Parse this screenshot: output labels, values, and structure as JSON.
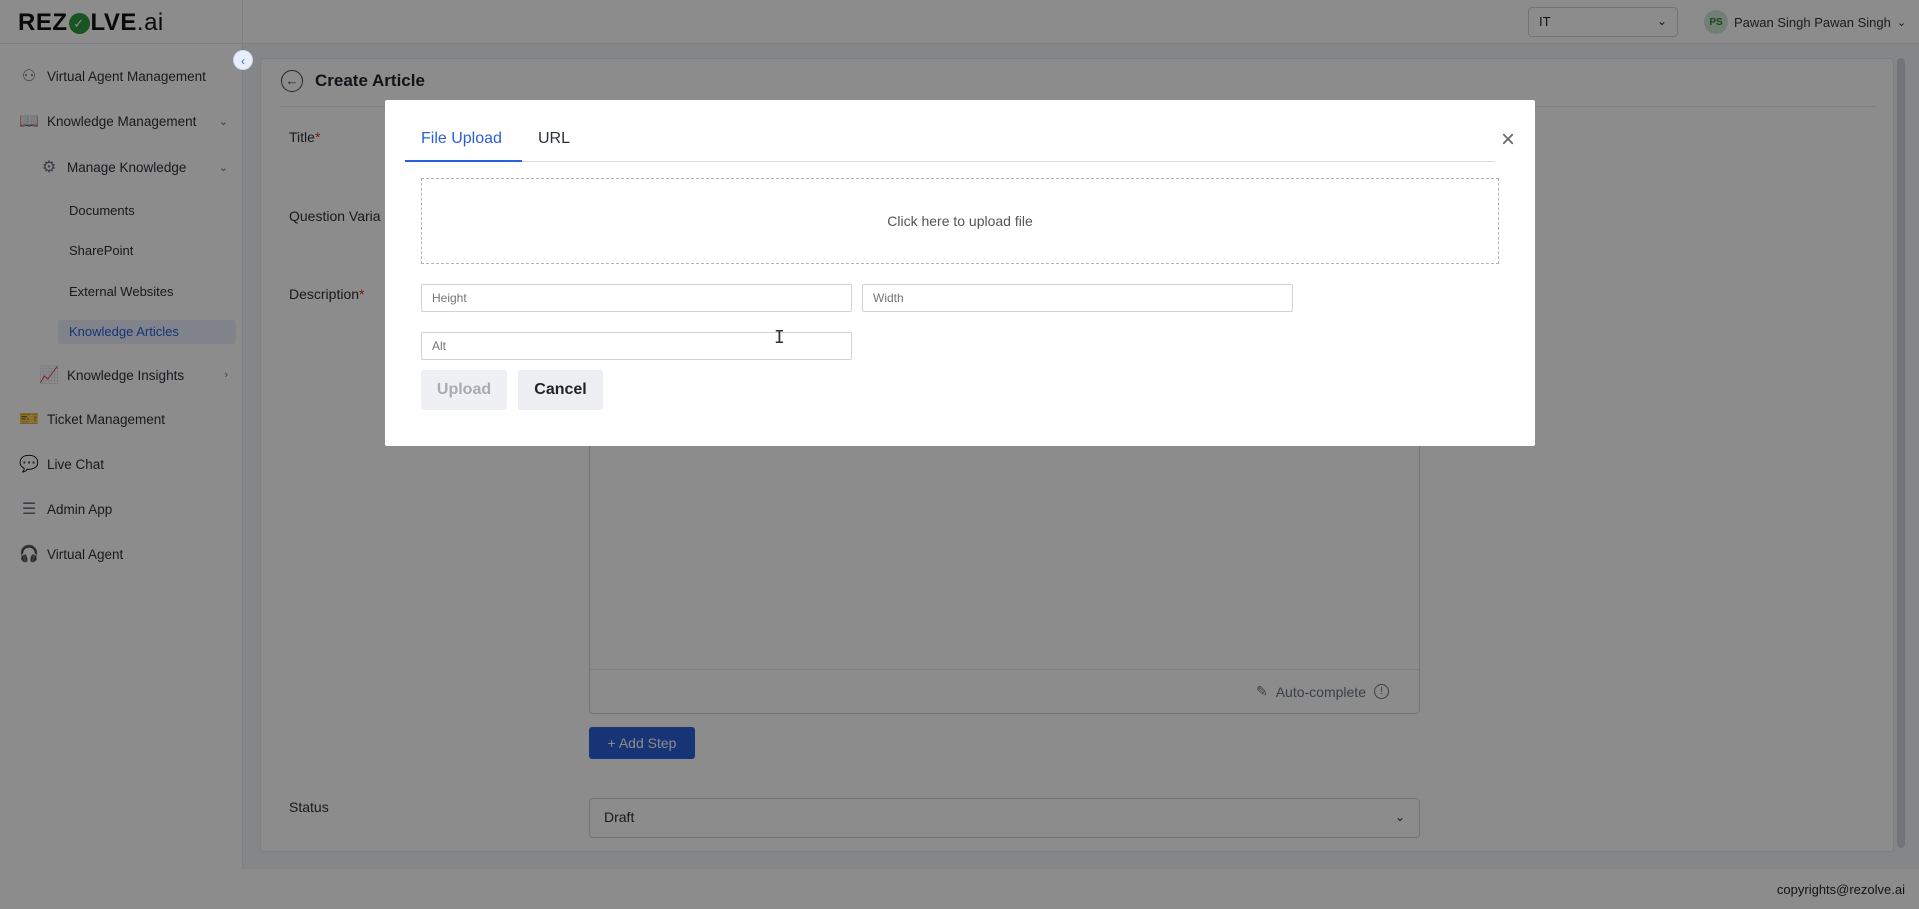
{
  "header": {
    "logo": {
      "prefix": "REZ",
      "mark": "✓",
      "suffix": "LVE",
      "ai": ".ai"
    },
    "department": "IT",
    "user": {
      "initials": "PS",
      "name": "Pawan Singh Pawan Singh"
    }
  },
  "sidebar": {
    "items": [
      {
        "label": "Virtual Agent Management"
      },
      {
        "label": "Knowledge Management"
      },
      {
        "label": "Manage Knowledge"
      },
      {
        "label": "Knowledge Insights"
      },
      {
        "label": "Ticket Management"
      },
      {
        "label": "Live Chat"
      },
      {
        "label": "Admin App"
      },
      {
        "label": "Virtual Agent"
      }
    ],
    "sub_items": [
      {
        "label": "Documents"
      },
      {
        "label": "SharePoint"
      },
      {
        "label": "External Websites"
      },
      {
        "label": "Knowledge Articles"
      }
    ]
  },
  "page": {
    "title": "Create Article",
    "labels": {
      "title": "Title",
      "question_variants": "Question Varia",
      "description": "Description",
      "status": "Status"
    },
    "required_mark": "*",
    "autocomplete": "Auto-complete",
    "add_step": "+ Add Step",
    "status_value": "Draft"
  },
  "modal": {
    "tabs": [
      {
        "label": "File Upload",
        "active": true
      },
      {
        "label": "URL",
        "active": false
      }
    ],
    "dropzone_text": "Click here to upload file",
    "height_placeholder": "Height",
    "width_placeholder": "Width",
    "alt_placeholder": "Alt",
    "upload_label": "Upload",
    "cancel_label": "Cancel"
  },
  "footer": {
    "copyright": "copyrights@rezolve.ai"
  },
  "colors": {
    "accent": "#2b5fd9",
    "brand_green": "#2e9b3e",
    "required": "#d92b2b"
  }
}
